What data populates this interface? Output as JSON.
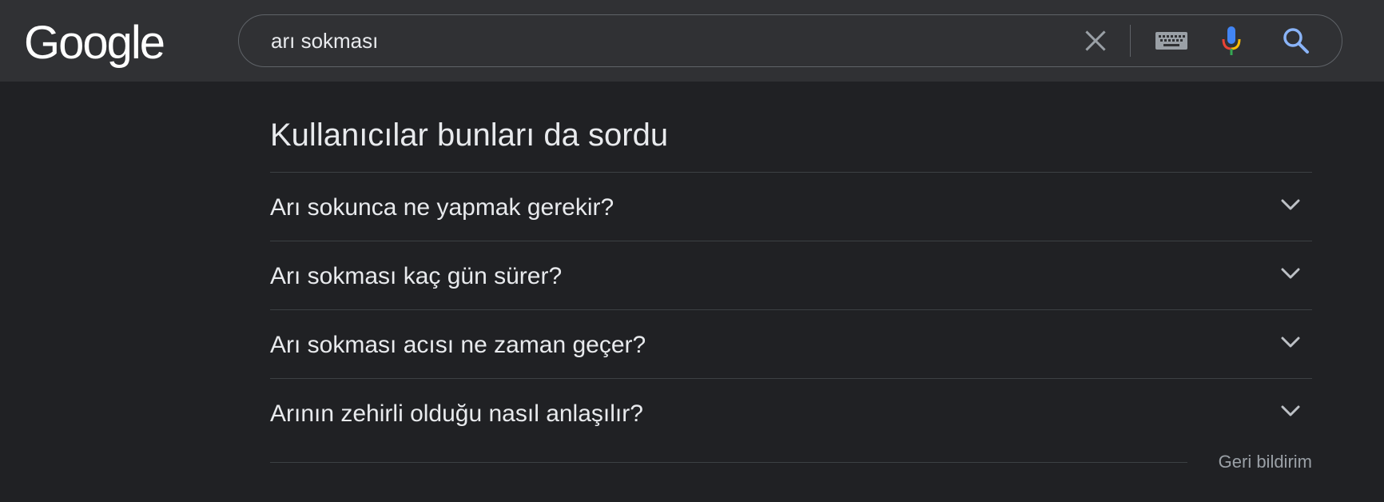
{
  "header": {
    "logo_text": "Google",
    "search": {
      "value": "arı sokması",
      "clear_icon": "close-icon",
      "keyboard_icon": "keyboard-icon",
      "mic_icon": "microphone-icon",
      "search_icon": "search-icon"
    }
  },
  "people_also_ask": {
    "title": "Kullanıcılar bunları da sordu",
    "questions": [
      {
        "text": "Arı sokunca ne yapmak gerekir?",
        "icon": "chevron-down-icon"
      },
      {
        "text": "Arı sokması kaç gün sürer?",
        "icon": "chevron-down-icon"
      },
      {
        "text": "Arı sokması acısı ne zaman geçer?",
        "icon": "chevron-down-icon"
      },
      {
        "text": "Arının zehirli olduğu nasıl anlaşılır?",
        "icon": "chevron-down-icon"
      }
    ],
    "feedback_label": "Geri bildirim"
  },
  "colors": {
    "background": "#202124",
    "header_background": "#303134",
    "text_primary": "#e8eaed",
    "text_secondary": "#9aa0a6",
    "divider": "#3c4043",
    "search_icon_blue": "#8ab4f8"
  }
}
